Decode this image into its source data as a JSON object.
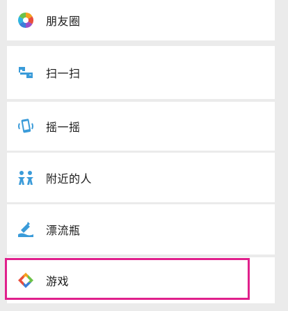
{
  "menu": {
    "items": [
      {
        "label": "朋友圈",
        "icon": "moments-icon"
      },
      {
        "label": "扫一扫",
        "icon": "scan-icon"
      },
      {
        "label": "摇一摇",
        "icon": "shake-icon"
      },
      {
        "label": "附近的人",
        "icon": "people-nearby-icon"
      },
      {
        "label": "漂流瓶",
        "icon": "drift-bottle-icon"
      },
      {
        "label": "游戏",
        "icon": "games-icon"
      }
    ]
  },
  "highlight": {
    "target": "游戏",
    "color": "#e0208c"
  },
  "colors": {
    "accent_blue": "#3a9bd9",
    "background": "#ebebeb",
    "row_background": "#ffffff"
  }
}
